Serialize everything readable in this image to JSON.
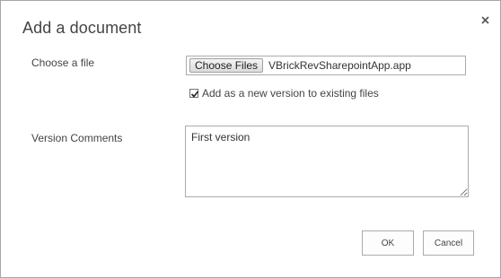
{
  "dialog": {
    "title": "Add a document",
    "close_icon": "close-icon"
  },
  "file_section": {
    "label": "Choose a file",
    "choose_button_label": "Choose Files",
    "selected_file": "VBrickRevSharepointApp.app",
    "checkbox_label": "Add as a new version to existing files",
    "checkbox_checked": true
  },
  "comments_section": {
    "label": "Version Comments",
    "value": "First version"
  },
  "footer": {
    "ok_label": "OK",
    "cancel_label": "Cancel"
  }
}
